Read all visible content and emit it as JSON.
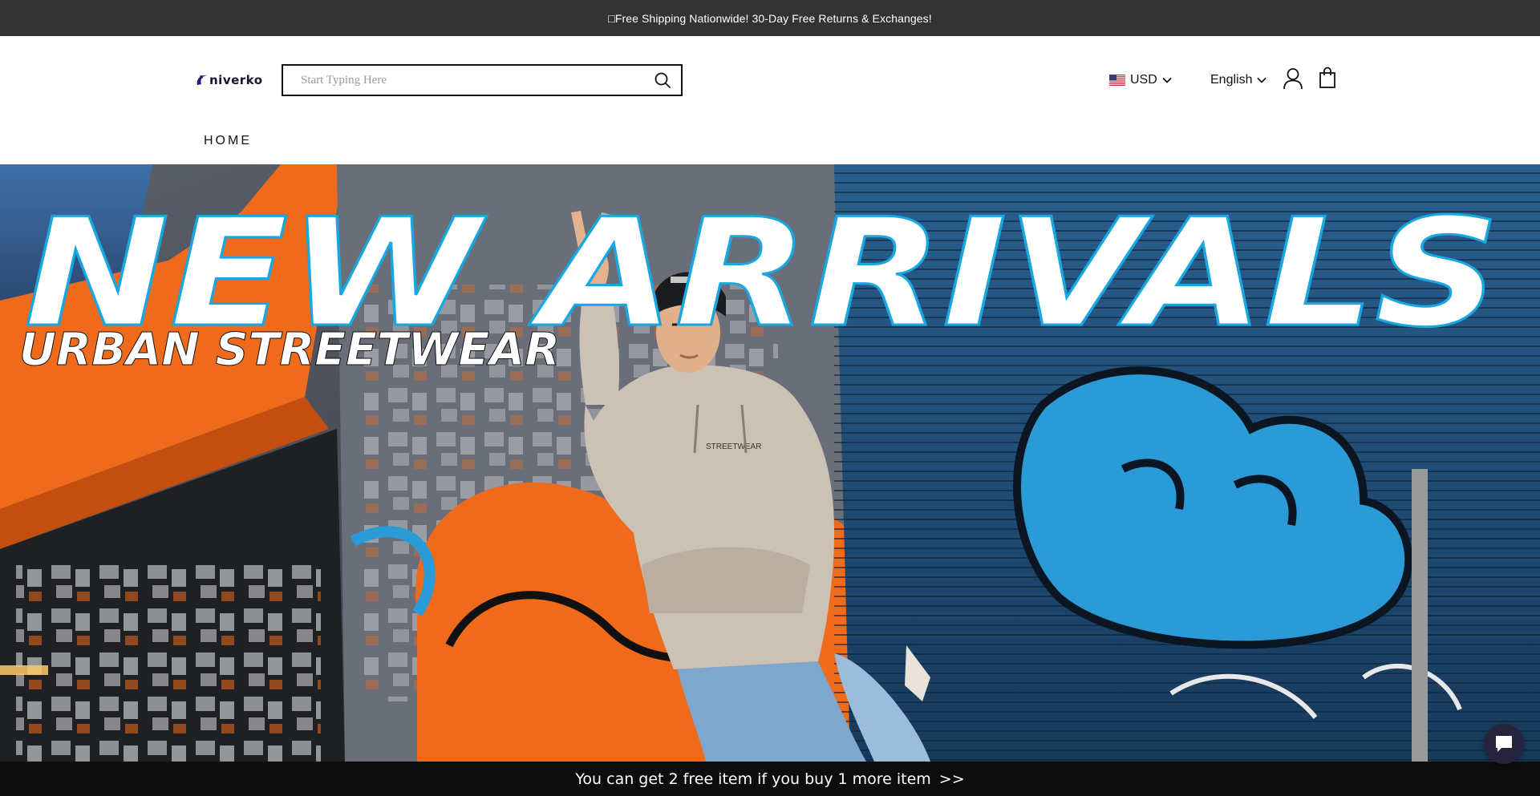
{
  "announcement": {
    "text": "□Free Shipping Nationwide! 30-Day Free Returns & Exchanges!"
  },
  "header": {
    "logo": {
      "text": "niverko"
    },
    "search": {
      "placeholder": "Start Typing Here",
      "value": "",
      "icon": "search-icon"
    },
    "currency": {
      "label": "USD",
      "flag": "us-flag",
      "icon": "chevron-down-icon"
    },
    "language": {
      "label": "English",
      "icon": "chevron-down-icon"
    },
    "account_icon": "user-icon",
    "cart_icon": "shopping-bag-icon"
  },
  "nav": {
    "items": [
      {
        "label": "HOME"
      }
    ]
  },
  "hero": {
    "headline": "NEW ARRIVALS",
    "subheadline": "URBAN STREETWEAR",
    "colors": {
      "accent_orange": "#f06a1c",
      "accent_blue": "#2a9bd6",
      "text_outline": "#18a7e0"
    }
  },
  "promo": {
    "text": "You can get 2 free item if you buy 1 more item",
    "arrows": ">>"
  },
  "chat": {
    "icon": "chat-bubble-icon"
  },
  "colors": {
    "announcement_bg": "#333333",
    "promo_bg": "#0d0d0d",
    "chat_bg": "#25243a"
  }
}
